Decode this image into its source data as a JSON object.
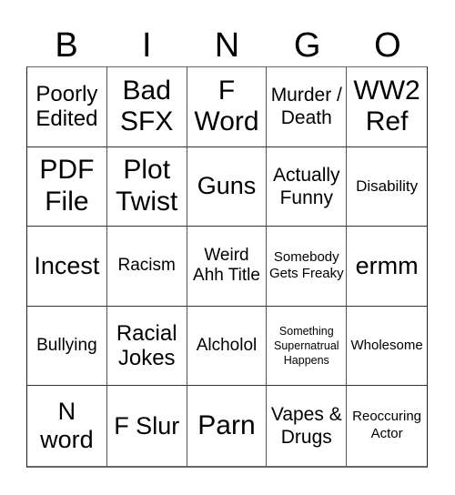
{
  "header": {
    "letters": [
      "B",
      "I",
      "N",
      "G",
      "O"
    ]
  },
  "cells": [
    [
      "Poorly Edited",
      "Bad SFX",
      "F Word",
      "Murder / Death",
      "WW2 Ref"
    ],
    [
      "PDF File",
      "Plot Twist",
      "Guns",
      "Actually Funny",
      "Disability"
    ],
    [
      "Incest",
      "Racism",
      "Weird Ahh Title",
      "Somebody Gets Freaky",
      "ermm"
    ],
    [
      "Bullying",
      "Racial Jokes",
      "Alcholol",
      "Something Supernatrual Happens",
      "Wholesome"
    ],
    [
      "N word",
      "F Slur",
      "Parn",
      "Vapes & Drugs",
      "Reoccuring Actor"
    ]
  ]
}
